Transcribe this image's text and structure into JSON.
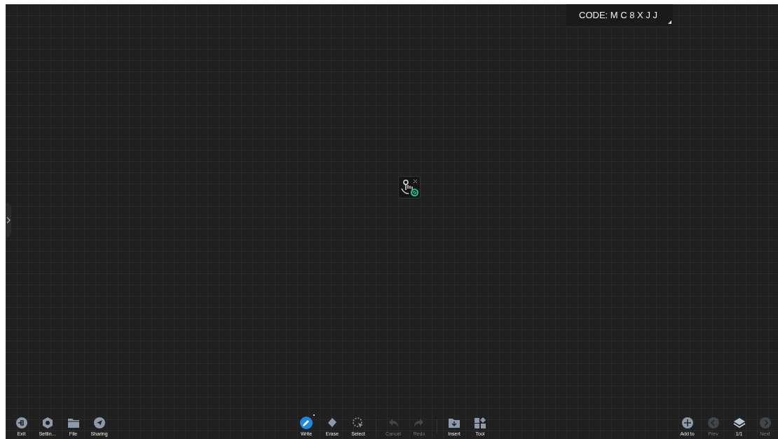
{
  "code_badge": {
    "text": "CODE: M C 8 X J J"
  },
  "toolbar": {
    "groups": [
      {
        "items": [
          {
            "kind": "exit",
            "label": "Exit",
            "selected": false,
            "disabled": false
          },
          {
            "kind": "settings",
            "label": "Settin...",
            "selected": false,
            "disabled": false
          },
          {
            "kind": "file",
            "label": "File",
            "selected": false,
            "disabled": false
          },
          {
            "kind": "share",
            "label": "Sharing",
            "selected": false,
            "disabled": false
          }
        ]
      },
      {
        "items": [
          {
            "kind": "write",
            "label": "Write",
            "selected": true,
            "disabled": false
          },
          {
            "kind": "erase",
            "label": "Erase",
            "selected": false,
            "disabled": false
          },
          {
            "kind": "select",
            "label": "Select",
            "selected": false,
            "disabled": false
          },
          {
            "kind": "divider"
          },
          {
            "kind": "undo",
            "label": "Cancel",
            "selected": false,
            "disabled": true
          },
          {
            "kind": "redo",
            "label": "Redo",
            "selected": false,
            "disabled": true
          },
          {
            "kind": "divider"
          },
          {
            "kind": "insert",
            "label": "Insert",
            "selected": false,
            "disabled": false
          },
          {
            "kind": "tool",
            "label": "Tool",
            "selected": false,
            "disabled": false
          }
        ]
      },
      {
        "items": [
          {
            "kind": "add",
            "label": "Add to",
            "selected": false,
            "disabled": false
          },
          {
            "kind": "prev",
            "label": "Prev",
            "selected": false,
            "disabled": true
          },
          {
            "kind": "pages",
            "label": "1/1",
            "selected": false,
            "disabled": false
          },
          {
            "kind": "next",
            "label": "Next",
            "selected": false,
            "disabled": true
          }
        ]
      }
    ]
  }
}
